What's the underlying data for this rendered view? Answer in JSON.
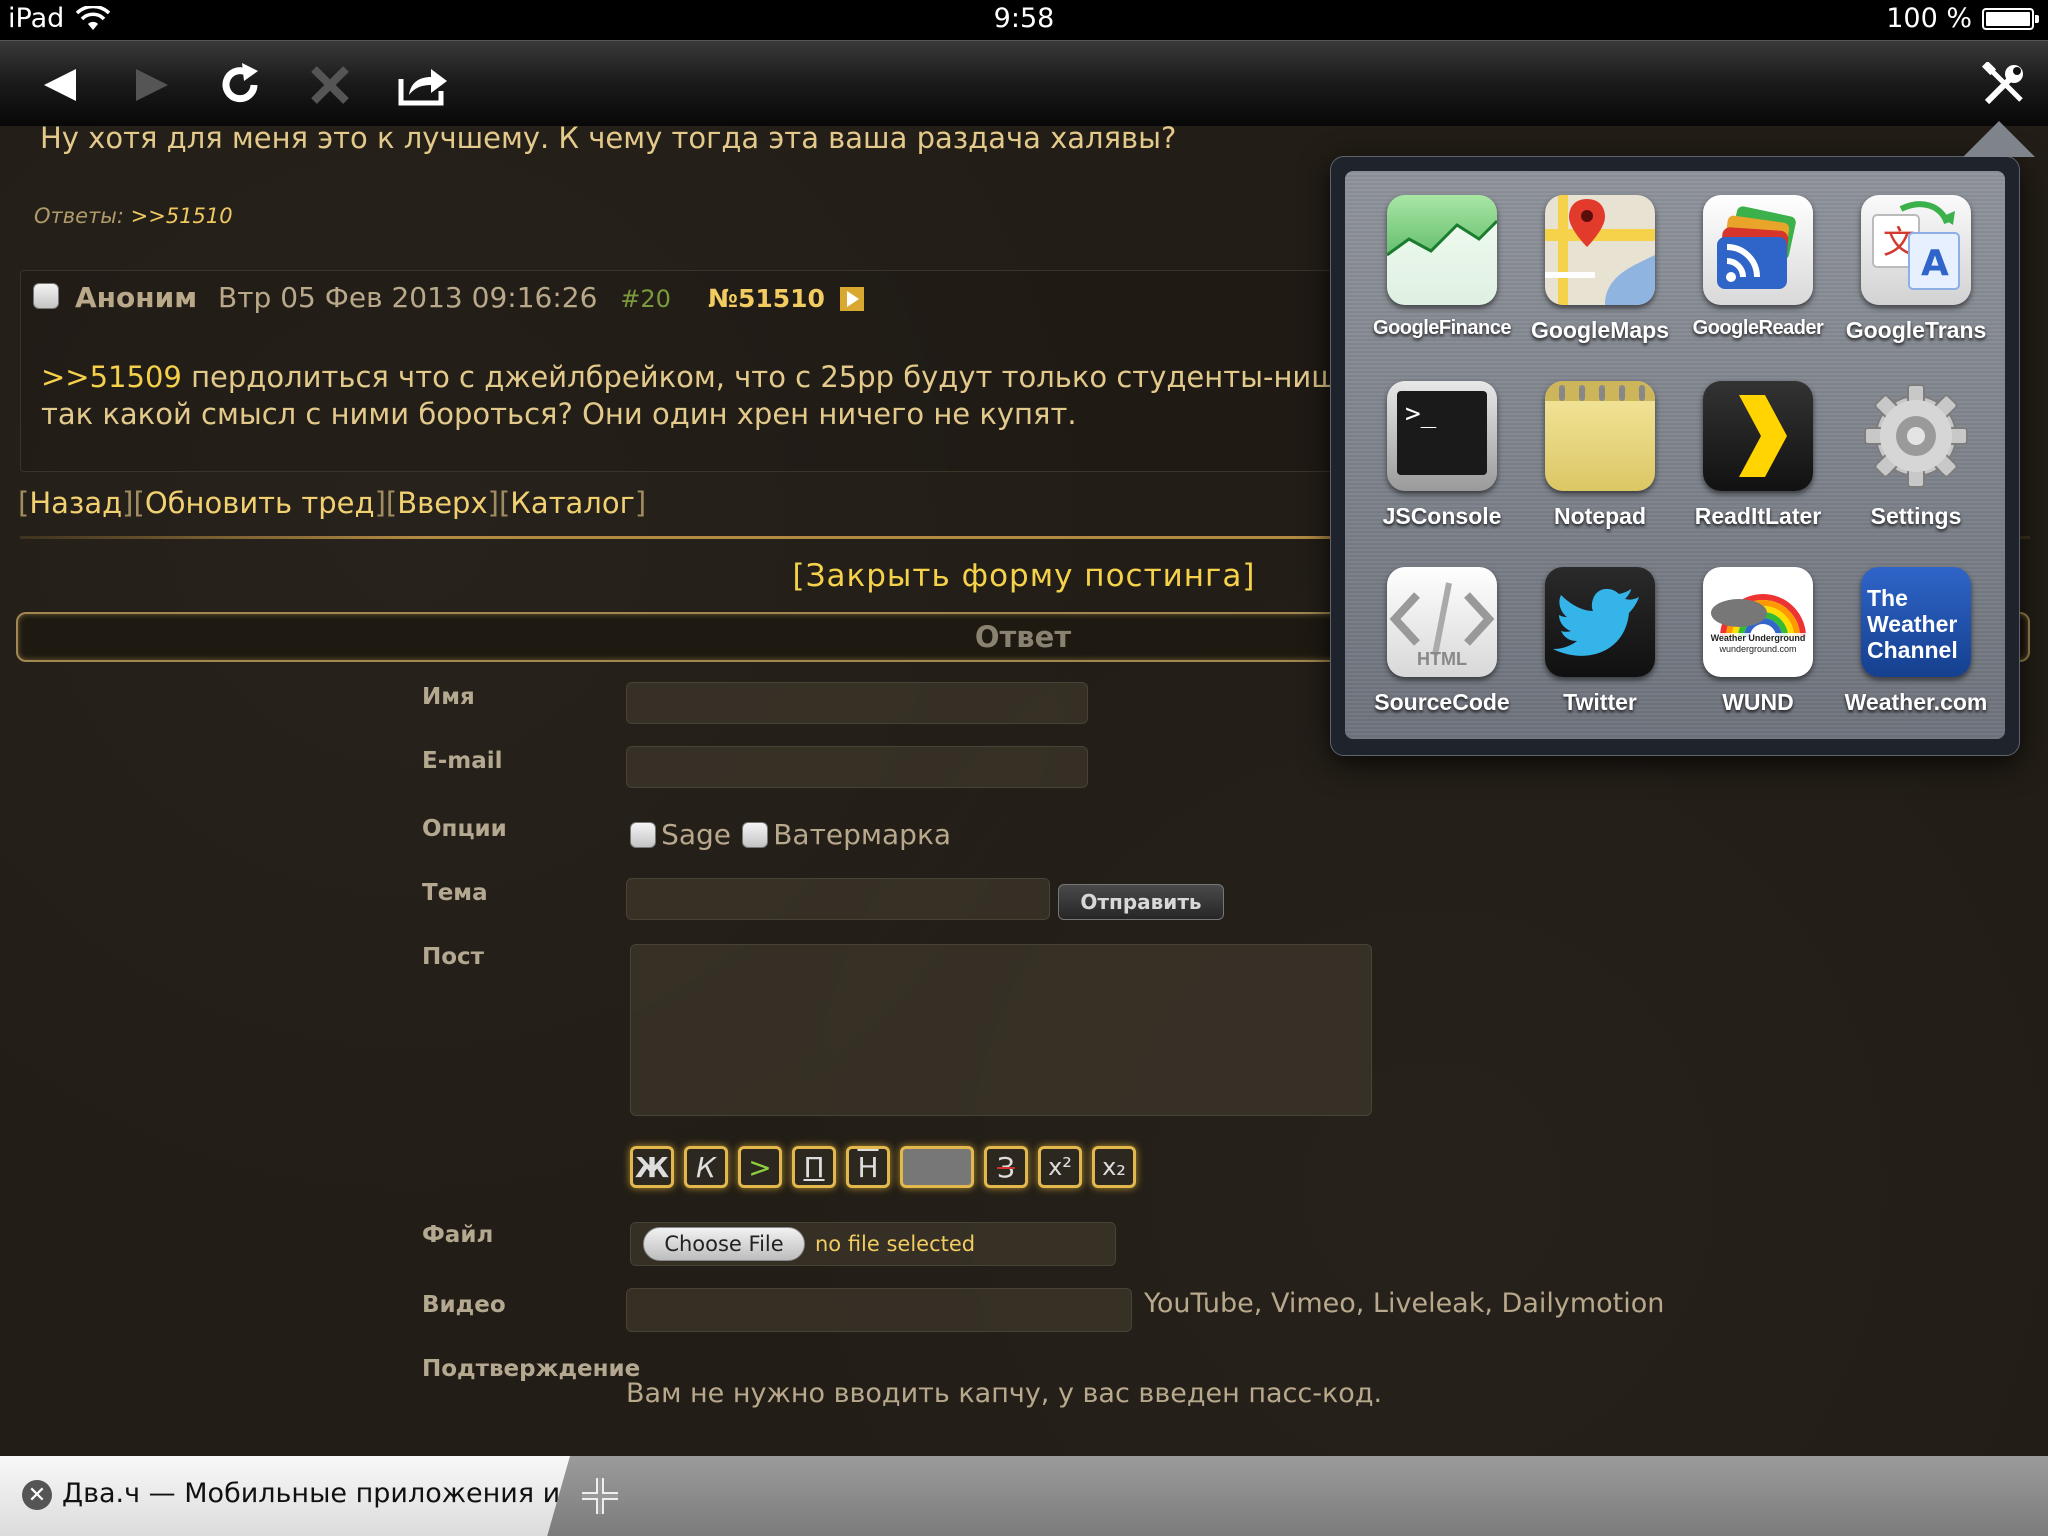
{
  "status_bar": {
    "device": "iPad",
    "time": "9:58",
    "battery": "100 %",
    "battery_level": 1.0,
    "wifi_icon": "wifi-icon"
  },
  "toolbar": {
    "buttons": [
      "back-icon",
      "forward-icon",
      "reload-icon",
      "stop-icon",
      "share-icon",
      "tools-icon"
    ]
  },
  "thread": {
    "prev_post_text": "Ну хотя для меня это к лучшему. К чему тогда эта ваша раздача халявы?",
    "replies_label": "Ответы:",
    "replies_link": ">>51510",
    "post": {
      "author": "Аноним",
      "date": "Втр 05 Фев 2013 09:16:26",
      "index": "#20",
      "number": "№51510",
      "quote": ">>51509",
      "text_line1": "пердолиться что с джейлбрейком, что с 25pp будут только студенты-нищебро",
      "text_line2": "так какой смысл с ними бороться? Они один хрен ничего не купят."
    }
  },
  "nav": {
    "back": "Назад",
    "refresh": "Обновить тред",
    "up": "Вверх",
    "catalog": "Каталог",
    "open_bracket": "[",
    "close_bracket": "]"
  },
  "form": {
    "close_form": "[Закрыть форму постинга]",
    "title": "Ответ",
    "name_label": "Имя",
    "email_label": "E-mail",
    "options_label": "Опции",
    "option_sage": "Sage",
    "option_watermark": "Ватермарка",
    "subject_label": "Тема",
    "submit": "Отправить",
    "post_label": "Пост",
    "format_buttons": [
      "Ж",
      "К",
      ">",
      "П",
      "Н",
      "",
      "З",
      "x²",
      "x₂"
    ],
    "file_label": "Файл",
    "choose_file": "Choose File",
    "no_file": "no file selected",
    "video_label": "Видео",
    "video_hint": "YouTube, Vimeo, Liveleak, Dailymotion",
    "confirm_label": "Подтверждение",
    "confirm_text": "Вам не нужно вводить капчу, у вас введен пасс-код."
  },
  "popover": {
    "apps": [
      {
        "name": "GoogleFinance",
        "icon": "google-finance-icon"
      },
      {
        "name": "GoogleMaps",
        "icon": "google-maps-icon"
      },
      {
        "name": "GoogleReader",
        "icon": "google-reader-icon"
      },
      {
        "name": "GoogleTrans",
        "icon": "google-translate-icon"
      },
      {
        "name": "JSConsole",
        "icon": "terminal-icon"
      },
      {
        "name": "Notepad",
        "icon": "notepad-icon"
      },
      {
        "name": "ReadItLater",
        "icon": "read-it-later-icon"
      },
      {
        "name": "Settings",
        "icon": "gear-icon"
      },
      {
        "name": "SourceCode",
        "icon": "html-source-icon"
      },
      {
        "name": "Twitter",
        "icon": "twitter-bird-icon"
      },
      {
        "name": "WUND",
        "icon": "weather-underground-icon"
      },
      {
        "name": "Weather.com",
        "icon": "weather-channel-icon"
      }
    ],
    "icon_text": {
      "terminal": ">_",
      "html": "HTML",
      "wund_brand": "Weather Underground",
      "wund_site": "wunderground.com",
      "twc": "The Weather Channel"
    }
  },
  "tabbar": {
    "tab_title": "Два.ч — Мобильные приложения и...",
    "new_tab_icon": "plus-icon"
  }
}
